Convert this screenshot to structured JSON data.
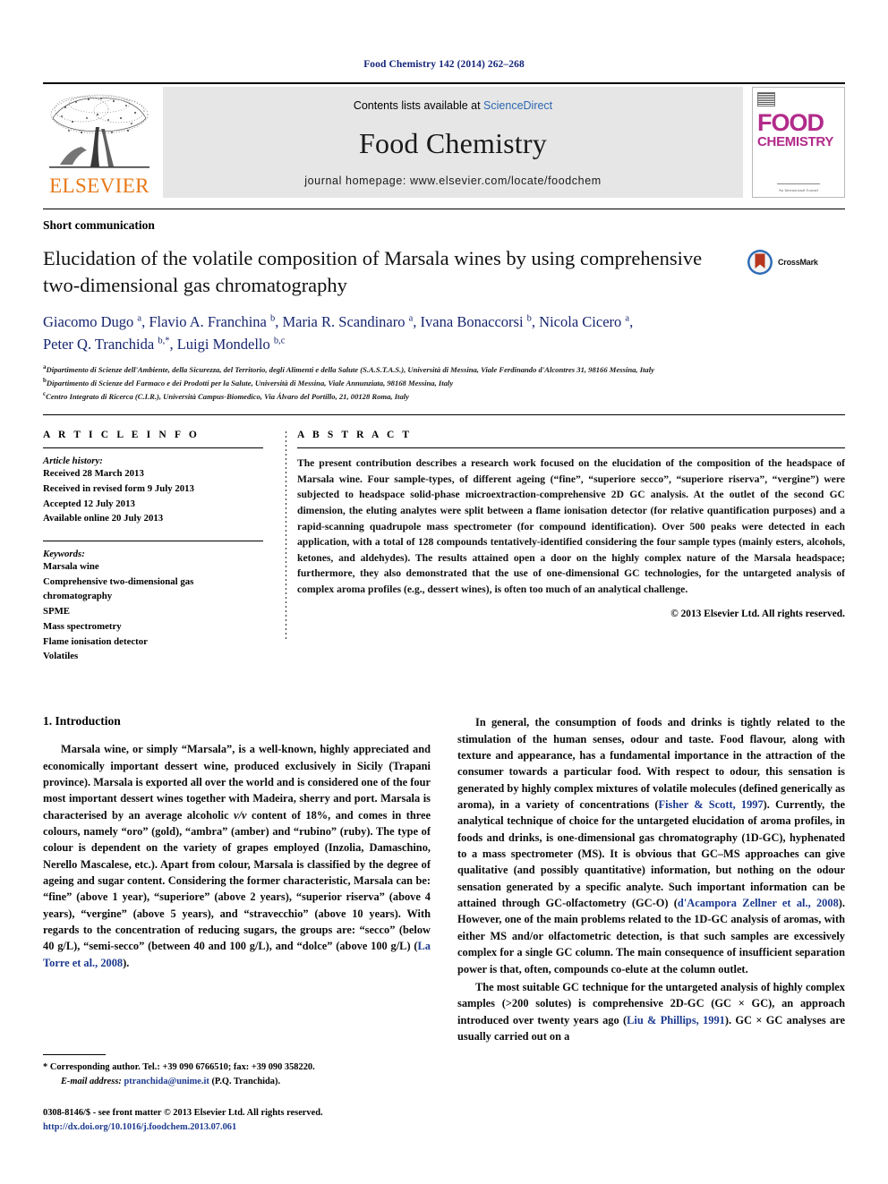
{
  "running_head": "Food Chemistry 142 (2014) 262–268",
  "banner": {
    "publisher_name": "ELSEVIER",
    "contents_prefix": "Contents lists available at ",
    "contents_link": "ScienceDirect",
    "journal_name": "Food Chemistry",
    "homepage": "journal homepage: www.elsevier.com/locate/foodchem",
    "cover": {
      "title_top": "FOOD",
      "title_bottom": "CHEMISTRY",
      "footer_text": "An International Journal"
    }
  },
  "article": {
    "section_type": "Short communication",
    "title": "Elucidation of the volatile composition of Marsala wines by using comprehensive two-dimensional gas chromatography",
    "crossmark_label": "CrossMark",
    "authors_line_1": "Giacomo Dugo a, Flavio A. Franchina b, Maria R. Scandinaro a, Ivana Bonaccorsi b, Nicola Cicero a,",
    "authors_line_2": "Peter Q. Tranchida b,*, Luigi Mondello b,c",
    "affiliations": [
      {
        "marker": "a",
        "text": "Dipartimento di Scienze dell'Ambiente, della Sicurezza, del Territorio, degli Alimenti e della Salute (S.A.S.T.A.S.), Università di Messina, Viale Ferdinando d'Alcontres 31, 98166 Messina, Italy"
      },
      {
        "marker": "b",
        "text": "Dipartimento di Scienze del Farmaco e dei Prodotti per la Salute, Università di Messina, Viale Annunziata, 98168 Messina, Italy"
      },
      {
        "marker": "c",
        "text": "Centro Integrato di Ricerca (C.I.R.), Università Campus-Biomedico, Via Álvaro del Portillo, 21, 00128 Roma, Italy"
      }
    ]
  },
  "article_info": {
    "heading": "A R T I C L E   I N F O",
    "history_title": "Article history:",
    "history": [
      "Received 28 March 2013",
      "Received in revised form 9 July 2013",
      "Accepted 12 July 2013",
      "Available online 20 July 2013"
    ],
    "keywords_title": "Keywords:",
    "keywords": [
      "Marsala wine",
      "Comprehensive two-dimensional gas chromatography",
      "SPME",
      "Mass spectrometry",
      "Flame ionisation detector",
      "Volatiles"
    ]
  },
  "abstract": {
    "heading": "A B S T R A C T",
    "body": "The present contribution describes a research work focused on the elucidation of the composition of the headspace of Marsala wine. Four sample-types, of different ageing (“fine”, “superiore secco”, “superiore riserva”, “vergine”) were subjected to headspace solid-phase microextraction-comprehensive 2D GC analysis. At the outlet of the second GC dimension, the eluting analytes were split between a flame ionisation detector (for relative quantification purposes) and a rapid-scanning quadrupole mass spectrometer (for compound identification). Over 500 peaks were detected in each application, with a total of 128 compounds tentatively-identified considering the four sample types (mainly esters, alcohols, ketones, and aldehydes). The results attained open a door on the highly complex nature of the Marsala headspace; furthermore, they also demonstrated that the use of one-dimensional GC technologies, for the untargeted analysis of complex aroma profiles (e.g., dessert wines), is often too much of an analytical challenge.",
    "copyright": "© 2013 Elsevier Ltd. All rights reserved."
  },
  "introduction": {
    "heading": "1. Introduction",
    "left_paragraphs": [
      "Marsala wine, or simply “Marsala”, is a well-known, highly appreciated and economically important dessert wine, produced exclusively in Sicily (Trapani province). Marsala is exported all over the world and is considered one of the four most important dessert wines together with Madeira, sherry and port. Marsala is characterised by an average alcoholic v/v content of 18%, and comes in three colours, namely “oro” (gold), “ambra” (amber) and “rubino” (ruby). The type of colour is dependent on the variety of grapes employed (Inzolia, Damaschino, Nerello Mascalese, etc.). Apart from colour, Marsala is classified by the degree of ageing and sugar content. Considering the former characteristic, Marsala can be: “fine” (above 1 year), “superiore” (above 2 years), “superior riserva” (above 4 years), “vergine” (above 5 years), and “stravecchio” (above 10 years). With regards to the concentration of reducing sugars, the groups are: “secco” (below 40 g/L), “semi-secco” (between 40 and 100 g/L), and “dolce” (above 100 g/L) (La Torre et al., 2008)."
    ],
    "right_paragraphs": [
      "In general, the consumption of foods and drinks is tightly related to the stimulation of the human senses, odour and taste. Food flavour, along with texture and appearance, has a fundamental importance in the attraction of the consumer towards a particular food. With respect to odour, this sensation is generated by highly complex mixtures of volatile molecules (defined generically as aroma), in a variety of concentrations (Fisher & Scott, 1997). Currently, the analytical technique of choice for the untargeted elucidation of aroma profiles, in foods and drinks, is one-dimensional gas chromatography (1D-GC), hyphenated to a mass spectrometer (MS). It is obvious that GC–MS approaches can give qualitative (and possibly quantitative) information, but nothing on the odour sensation generated by a specific analyte. Such important information can be attained through GC-olfactometry (GC-O) (d'Acampora Zellner et al., 2008). However, one of the main problems related to the 1D-GC analysis of aromas, with either MS and/or olfactometric detection, is that such samples are excessively complex for a single GC column. The main consequence of insufficient separation power is that, often, compounds co-elute at the column outlet.",
      "The most suitable GC technique for the untargeted analysis of highly complex samples (>200 solutes) is comprehensive 2D-GC (GC × GC), an approach introduced over twenty years ago (Liu & Phillips, 1991). GC × GC analyses are usually carried out on a"
    ]
  },
  "footer": {
    "corresponding_marker": "*",
    "corresponding_text": "Corresponding author. Tel.: +39 090 6766510; fax: +39 090 358220.",
    "email_label": "E-mail address:",
    "email_value": "ptranchida@unime.it",
    "email_owner": "(P.Q. Tranchida).",
    "imprint": "0308-8146/$ - see front matter © 2013 Elsevier Ltd. All rights reserved.",
    "doi": "http://dx.doi.org/10.1016/j.foodchem.2013.07.061"
  },
  "colors": {
    "link_blue": "#1d3a8f",
    "running_head_blue": "#14257a",
    "elsevier_orange": "#e77817",
    "cover_magenta": "#b22a8a",
    "sciencedirect_blue": "#2c67b0"
  }
}
